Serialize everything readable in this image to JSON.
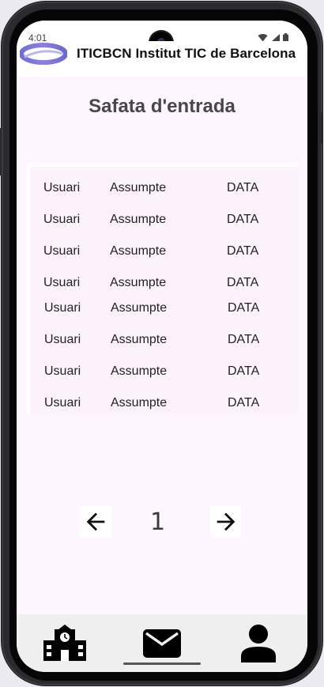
{
  "status_bar": {
    "time": "4:01",
    "icons": [
      "wifi-icon",
      "signal-icon",
      "battery-icon"
    ]
  },
  "app_bar": {
    "title": "ITICBCN Institut TIC de Barcelona",
    "logo": "iticbcn-logo"
  },
  "page": {
    "title": "Safata d'entrada"
  },
  "inbox": {
    "rows": [
      {
        "user": "Usuari",
        "subject": "Assumpte",
        "date": "DATA"
      },
      {
        "user": "Usuari",
        "subject": "Assumpte",
        "date": "DATA"
      },
      {
        "user": "Usuari",
        "subject": "Assumpte",
        "date": "DATA"
      },
      {
        "user": "Usuari",
        "subject": "Assumpte",
        "date": "DATA"
      },
      {
        "user": "Usuari",
        "subject": "Assumpte",
        "date": "DATA"
      },
      {
        "user": "Usuari",
        "subject": "Assumpte",
        "date": "DATA"
      },
      {
        "user": "Usuari",
        "subject": "Assumpte",
        "date": "DATA"
      },
      {
        "user": "Usuari",
        "subject": "Assumpte",
        "date": "DATA"
      }
    ]
  },
  "pagination": {
    "current_page": "1",
    "prev_icon": "arrow-left-icon",
    "next_icon": "arrow-right-icon"
  },
  "bottom_nav": {
    "items": [
      {
        "icon": "school-icon"
      },
      {
        "icon": "mail-icon"
      },
      {
        "icon": "person-icon"
      }
    ]
  },
  "colors": {
    "background": "#fdf6fe",
    "text_primary": "#222222",
    "title": "#48454e",
    "nav_background": "#efefef"
  }
}
